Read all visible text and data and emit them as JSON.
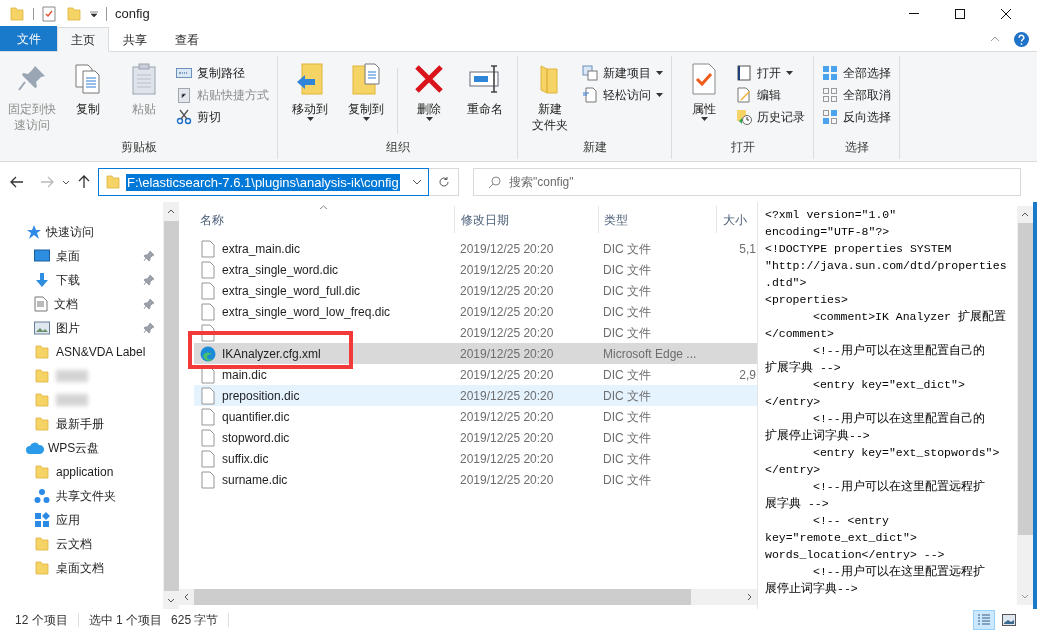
{
  "window": {
    "title": "config"
  },
  "ribbon": {
    "file_tab": "文件",
    "tabs": [
      {
        "label": "主页",
        "selected": true
      },
      {
        "label": "共享",
        "selected": false
      },
      {
        "label": "查看",
        "selected": false
      }
    ],
    "groups": [
      {
        "label": "剪贴板",
        "buttons": [
          {
            "kind": "large",
            "label": "固定到快速访问",
            "disabled": true,
            "dropdown": false
          },
          {
            "kind": "large",
            "label": "复制",
            "disabled": false,
            "dropdown": false
          },
          {
            "kind": "large",
            "label": "粘贴",
            "disabled": true,
            "dropdown": false
          },
          {
            "kind": "small",
            "label": "复制路径",
            "disabled": false,
            "dropdown": false
          },
          {
            "kind": "small",
            "label": "粘贴快捷方式",
            "disabled": true,
            "dropdown": false
          },
          {
            "kind": "small",
            "label": "剪切",
            "disabled": false,
            "dropdown": false
          }
        ]
      },
      {
        "label": "组织",
        "buttons": [
          {
            "kind": "large",
            "label": "移动到",
            "disabled": false,
            "dropdown": true
          },
          {
            "kind": "large",
            "label": "复制到",
            "disabled": false,
            "dropdown": true
          },
          {
            "kind": "separator"
          },
          {
            "kind": "large",
            "label": "删除",
            "disabled": false,
            "dropdown": true
          },
          {
            "kind": "large",
            "label": "重命名",
            "disabled": false,
            "dropdown": false
          }
        ]
      },
      {
        "label": "新建",
        "buttons": [
          {
            "kind": "large",
            "label": [
              "新建",
              "文件夹"
            ],
            "disabled": false,
            "dropdown": false
          },
          {
            "kind": "small",
            "label": "新建项目",
            "disabled": false,
            "dropdown": true
          },
          {
            "kind": "small",
            "label": "轻松访问",
            "disabled": false,
            "dropdown": true
          }
        ]
      },
      {
        "label": "打开",
        "buttons": [
          {
            "kind": "large",
            "label": "属性",
            "disabled": false,
            "dropdown": true
          },
          {
            "kind": "small",
            "label": "打开",
            "disabled": false,
            "dropdown": true
          },
          {
            "kind": "small",
            "label": "编辑",
            "disabled": false,
            "dropdown": false
          },
          {
            "kind": "small",
            "label": "历史记录",
            "disabled": false,
            "dropdown": false
          }
        ]
      },
      {
        "label": "选择",
        "buttons": [
          {
            "kind": "small",
            "label": "全部选择",
            "disabled": false,
            "dropdown": false
          },
          {
            "kind": "small",
            "label": "全部取消",
            "disabled": false,
            "dropdown": false
          },
          {
            "kind": "small",
            "label": "反向选择",
            "disabled": false,
            "dropdown": false
          }
        ]
      }
    ]
  },
  "address_bar": {
    "path": "F:\\elasticsearch-7.6.1\\plugins\\analysis-ik\\config",
    "path_selected": true
  },
  "search": {
    "placeholder": "搜索\"config\""
  },
  "sidebar": {
    "items": [
      {
        "kind": "header",
        "label": "快速访问"
      },
      {
        "kind": "item",
        "label": "桌面",
        "pinned": true
      },
      {
        "kind": "item",
        "label": "下载",
        "pinned": true
      },
      {
        "kind": "item",
        "label": "文档",
        "pinned": true
      },
      {
        "kind": "item",
        "label": "图片",
        "pinned": true
      },
      {
        "kind": "item",
        "label": "ASN&VDA Label",
        "pinned": false
      },
      {
        "kind": "redacted"
      },
      {
        "kind": "redacted"
      },
      {
        "kind": "item",
        "label": "最新手册",
        "pinned": false
      },
      {
        "kind": "header",
        "label": "WPS云盘"
      },
      {
        "kind": "item",
        "label": "application",
        "pinned": false
      },
      {
        "kind": "item",
        "label": "共享文件夹",
        "pinned": false
      },
      {
        "kind": "item",
        "label": "应用",
        "pinned": false
      },
      {
        "kind": "item",
        "label": "云文档",
        "pinned": false
      },
      {
        "kind": "item",
        "label": "桌面文档",
        "pinned": false
      }
    ]
  },
  "file_list": {
    "columns": [
      "名称",
      "修改日期",
      "类型",
      "大小"
    ],
    "rows": [
      {
        "kind": "dic",
        "name": "extra_main.dic",
        "modified": "2019/12/25 20:20",
        "type": "DIC 文件",
        "size": "5,1",
        "selected": false,
        "hovered": false
      },
      {
        "kind": "dic",
        "name": "extra_single_word.dic",
        "modified": "2019/12/25 20:20",
        "type": "DIC 文件",
        "selected": false,
        "hovered": false
      },
      {
        "kind": "dic",
        "name": "extra_single_word_full.dic",
        "modified": "2019/12/25 20:20",
        "type": "DIC 文件",
        "selected": false,
        "hovered": false
      },
      {
        "kind": "dic",
        "name": "extra_single_word_low_freq.dic",
        "modified": "2019/12/25 20:20",
        "type": "DIC 文件",
        "selected": false,
        "hovered": false
      },
      {
        "kind": "dic",
        "modified": "2019/12/25 20:20",
        "type": "DIC 文件",
        "selected": false,
        "hovered": false
      },
      {
        "kind": "xml",
        "name": "IKAnalyzer.cfg.xml",
        "modified": "2019/12/25 20:20",
        "type": "Microsoft Edge ...",
        "selected": true,
        "hovered": false
      },
      {
        "kind": "dic",
        "name": "main.dic",
        "modified": "2019/12/25 20:20",
        "type": "DIC 文件",
        "size": "2,9",
        "selected": false,
        "hovered": false
      },
      {
        "kind": "dic",
        "name": "preposition.dic",
        "modified": "2019/12/25 20:20",
        "type": "DIC 文件",
        "selected": false,
        "hovered": true
      },
      {
        "kind": "dic",
        "name": "quantifier.dic",
        "modified": "2019/12/25 20:20",
        "type": "DIC 文件",
        "selected": false,
        "hovered": false
      },
      {
        "kind": "dic",
        "name": "stopword.dic",
        "modified": "2019/12/25 20:20",
        "type": "DIC 文件",
        "selected": false,
        "hovered": false
      },
      {
        "kind": "dic",
        "name": "suffix.dic",
        "modified": "2019/12/25 20:20",
        "type": "DIC 文件",
        "selected": false,
        "hovered": false
      },
      {
        "kind": "dic",
        "name": "surname.dic",
        "modified": "2019/12/25 20:20",
        "type": "DIC 文件",
        "selected": false,
        "hovered": false
      }
    ]
  },
  "preview": {
    "lines": [
      {
        "text": "<?xml version=\"1.0\"",
        "indented": false
      },
      {
        "text": "encoding=\"UTF-8\"?>",
        "indented": false
      },
      {
        "text": "<!DOCTYPE properties SYSTEM",
        "indented": false
      },
      {
        "text": "\"http://java.sun.com/dtd/properties",
        "indented": false
      },
      {
        "text": ".dtd\">",
        "indented": false
      },
      {
        "text": "<properties>",
        "indented": false
      },
      {
        "text": "<comment>IK Analyzer 扩展配置",
        "indented": true
      },
      {
        "text": "</comment>",
        "indented": false
      },
      {
        "text": "<!--用户可以在这里配置自己的",
        "indented": true
      },
      {
        "text": "扩展字典 -->",
        "indented": false
      },
      {
        "text": "<entry key=\"ext_dict\">",
        "indented": true
      },
      {
        "text": "</entry>",
        "indented": false
      },
      {
        "text": "<!--用户可以在这里配置自己的",
        "indented": true
      },
      {
        "text": "扩展停止词字典-->",
        "indented": false
      },
      {
        "text": "<entry key=\"ext_stopwords\">",
        "indented": true
      },
      {
        "text": "</entry>",
        "indented": false
      },
      {
        "text": "<!--用户可以在这里配置远程扩",
        "indented": true
      },
      {
        "text": "展字典 -->",
        "indented": false
      },
      {
        "text": "<!-- <entry",
        "indented": true
      },
      {
        "text": "key=\"remote_ext_dict\">",
        "indented": false
      },
      {
        "text": "words_location</entry> -->",
        "indented": false
      },
      {
        "text": "<!--用户可以在这里配置远程扩",
        "indented": true
      },
      {
        "text": "展停止词字典-->",
        "indented": false
      }
    ]
  },
  "status_bar": {
    "item_count": "12 个项目",
    "selection": "选中 1 个项目",
    "size": "625 字节",
    "views": [
      {
        "selected": true
      },
      {
        "selected": false
      }
    ]
  }
}
